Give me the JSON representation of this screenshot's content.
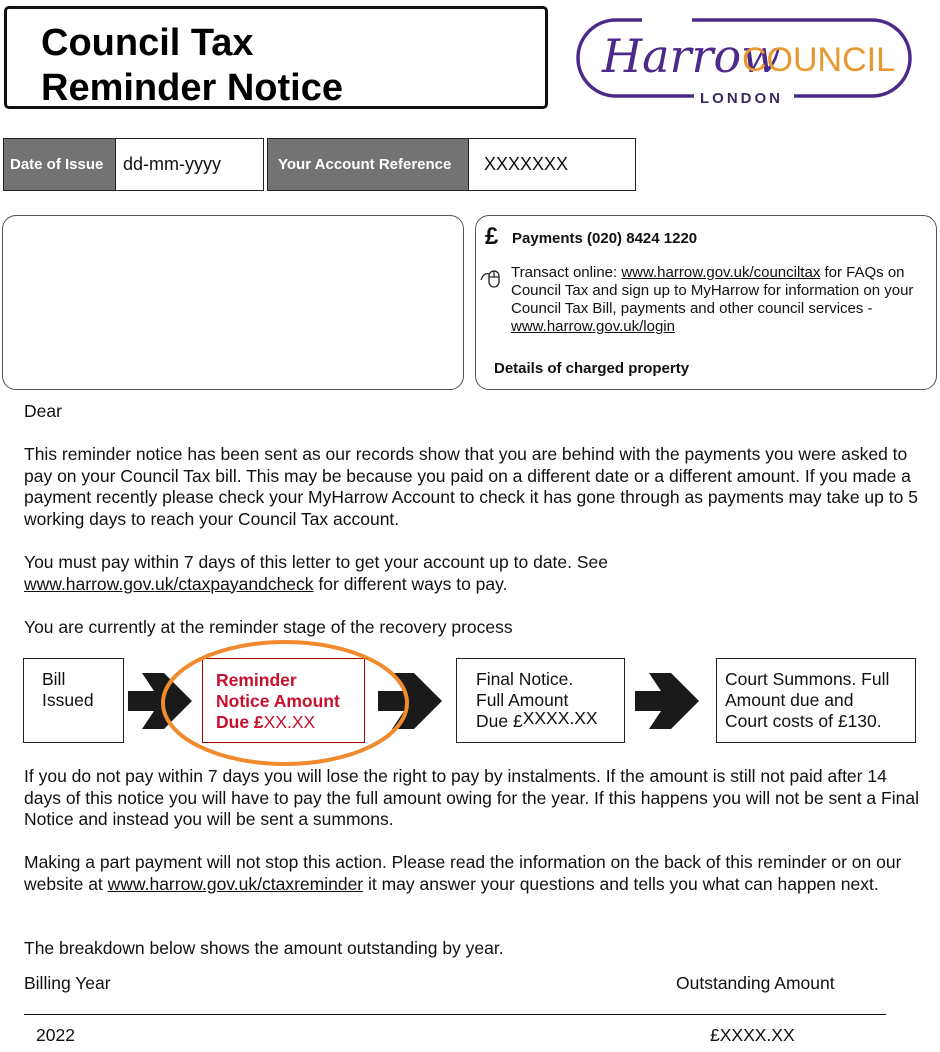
{
  "header": {
    "title_line1": "Council Tax",
    "title_line2": "Reminder Notice"
  },
  "logo": {
    "script_text": "Harrow",
    "council_text": "COUNCIL",
    "location_text": "LONDON",
    "purple": "#4b2a8a",
    "orange": "#e8982e"
  },
  "info": {
    "date_label": "Date of Issue",
    "date_value": "dd-mm-yyyy",
    "account_label": "Your Account Reference",
    "account_value": "XXXXXXX"
  },
  "payments": {
    "pound_icon": "£",
    "phone_line": "Payments (020) 8424 1220",
    "online_prefix": "Transact online: ",
    "online_link1": "www.harrow.gov.uk/counciltax",
    "online_middle": " for FAQs on Council Tax and sign up to MyHarrow for information on your Council Tax Bill, payments and other council services - ",
    "online_link2": "www.harrow.gov.uk/login",
    "details_label": "Details of charged property"
  },
  "letter": {
    "salutation": "Dear",
    "para1": "This reminder notice has been sent as our records show that you are behind with the payments you were asked to pay on your Council Tax bill. This may be because you paid on a different date or a different amount. If you made a payment recently please check your MyHarrow Account to check it has gone through as payments may take up to 5 working days to reach your Council Tax account.",
    "para2_prefix": "You must pay within 7 days of this letter to get your account up to date. See ",
    "para2_link": "www.harrow.gov.uk/ctaxpayandcheck",
    "para2_suffix": " for different ways to pay.",
    "stage_intro": "You are currently at the reminder stage of the recovery process",
    "para3": "If you do not pay within 7 days you will lose the right to pay by instalments. If the amount is still not paid after 14 days of this notice you will have to pay the full amount owing for the year. If this happens you will not be sent a Final Notice and instead you will be sent a summons.",
    "para4_prefix": "Making a part payment will not stop this action. Please read the information on the back of this reminder or on our website at ",
    "para4_link": "www.harrow.gov.uk/ctaxreminder",
    "para4_suffix": " it may answer your questions and tells you what can happen next.",
    "breakdown_intro": "The breakdown below shows the amount outstanding by year."
  },
  "process": {
    "stages": [
      {
        "line1": "Bill",
        "line2": "Issued",
        "line3": ""
      },
      {
        "line1": "Reminder",
        "line2": "Notice Amount",
        "line3_prefix": "Due £",
        "line3_value": "XX.XX"
      },
      {
        "line1": "Final Notice.",
        "line2": "Full Amount",
        "line3_prefix": "Due £",
        "line3_value": "XXXX.XX"
      },
      {
        "line1": "Court Summons. Full",
        "line2": "Amount due and",
        "line3": "Court costs of £130."
      }
    ],
    "current_stage_index": 1,
    "highlight_color": "#f08a2c",
    "current_color": "#c8102e"
  },
  "breakdown": {
    "columns": [
      "Billing Year",
      "Outstanding Amount"
    ],
    "rows": [
      {
        "year": "2022",
        "amount": "£XXXX.XX"
      }
    ]
  }
}
